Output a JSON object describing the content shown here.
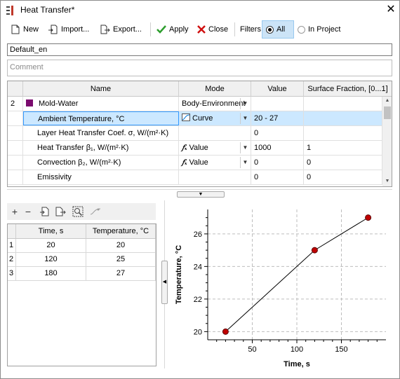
{
  "window": {
    "title": "Heat Transfer*",
    "close_glyph": "✕"
  },
  "toolbar": {
    "new_label": "New",
    "import_label": "Import...",
    "export_label": "Export...",
    "apply_label": "Apply",
    "close_label": "Close",
    "filters_label": "Filters:",
    "filter_all_label": "All",
    "filter_project_label": "In Project",
    "filter_selected": "All"
  },
  "name_field": {
    "value": "Default_en"
  },
  "comment_field": {
    "placeholder": "Comment"
  },
  "grid": {
    "columns": [
      "Name",
      "Mode",
      "Value",
      "Surface Fraction, [0...1]"
    ],
    "rows": [
      {
        "index": "2",
        "name": "Mold-Water",
        "mode": "Body-Environment",
        "value": "",
        "fraction": "",
        "swatch": "#7b0a6e"
      },
      {
        "index": "",
        "name": "Ambient Temperature, °C",
        "mode": "Curve",
        "value": "20 - 27",
        "fraction": "",
        "selected": true
      },
      {
        "index": "",
        "name": "Layer Heat Transfer Coef. σ, W/(m²·K)",
        "mode": "",
        "value": "0",
        "fraction": ""
      },
      {
        "index": "",
        "name": "Heat Transfer β₁, W/(m²·K)",
        "mode": "Value",
        "value": "1000",
        "fraction": "1"
      },
      {
        "index": "",
        "name": "Convection β₂, W/(m²·K)",
        "mode": "Value",
        "value": "0",
        "fraction": "0"
      },
      {
        "index": "",
        "name": "Emissivity",
        "mode": "",
        "value": "0",
        "fraction": "0"
      }
    ]
  },
  "curve_table": {
    "columns": [
      "Time, s",
      "Temperature, °C"
    ],
    "rows": [
      {
        "index": "1",
        "time": "20",
        "temp": "20"
      },
      {
        "index": "2",
        "time": "120",
        "temp": "25"
      },
      {
        "index": "3",
        "time": "180",
        "temp": "27"
      }
    ]
  },
  "colors": {
    "selection": "#cce8ff",
    "selection_border": "#3399ff",
    "point": "#c00000",
    "accent": "#0078d7"
  },
  "chart_data": {
    "type": "line",
    "x": [
      20,
      120,
      180
    ],
    "y": [
      20,
      25,
      27
    ],
    "xlabel": "Time, s",
    "ylabel": "Temperature, °C",
    "xlim": [
      0,
      200
    ],
    "ylim": [
      19.5,
      27.5
    ],
    "xticks": [
      50,
      100,
      150
    ],
    "yticks": [
      20,
      22,
      24,
      26
    ],
    "grid": true
  }
}
